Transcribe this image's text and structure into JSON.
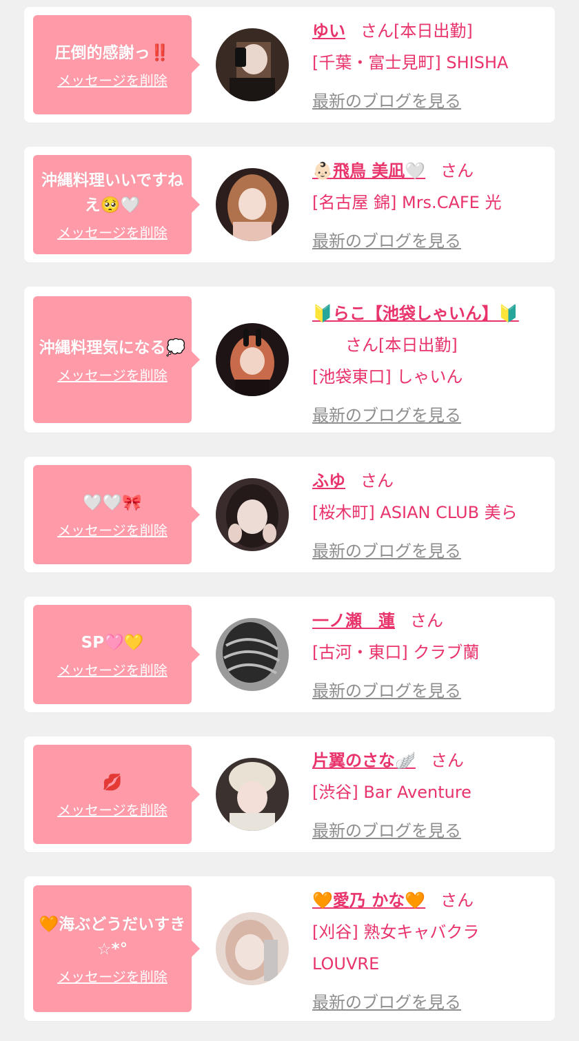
{
  "delete_label": "メッセージを削除",
  "blog_label": "最新のブログを見る",
  "colors": {
    "accent": "#e8336b",
    "bubble": "#ff9ba9",
    "background": "#f0f0f0",
    "link_gray": "#8e8e8e"
  },
  "items": [
    {
      "message": "圧倒的感謝っ‼️",
      "name": "ゆい",
      "honorific": "さん[本日出勤]",
      "shop": "[千葉・富士見町] SHISHA"
    },
    {
      "message": "沖縄料理いいですねえ🥺🤍",
      "name": "👶🏻飛鳥 美凪🤍",
      "honorific": "さん",
      "shop": "[名古屋 錦] Mrs.CAFE 光"
    },
    {
      "message": "沖縄料理気になる💭",
      "name": "🔰らこ【池袋しゃいん】🔰",
      "honorific": "さん[本日出勤]",
      "shop": "[池袋東口] しゃいん"
    },
    {
      "message": "🤍🤍🎀",
      "name": "ふゆ",
      "honorific": "さん",
      "shop": "[桜木町] ASIAN CLUB 美ら"
    },
    {
      "message": "SP🩷💛",
      "name": "一ノ瀬　蓮",
      "honorific": "さん",
      "shop": "[古河・東口] クラブ蘭"
    },
    {
      "message": "💋",
      "name": "片翼のさな🪽",
      "honorific": "さん",
      "shop": "[渋谷] Bar Aventure"
    },
    {
      "message": "🧡海ぶどうだいすき☆*°",
      "name": "🧡愛乃 かな🧡",
      "honorific": "さん",
      "shop": "[刈谷] 熟女キャバクラ LOUVRE"
    }
  ]
}
